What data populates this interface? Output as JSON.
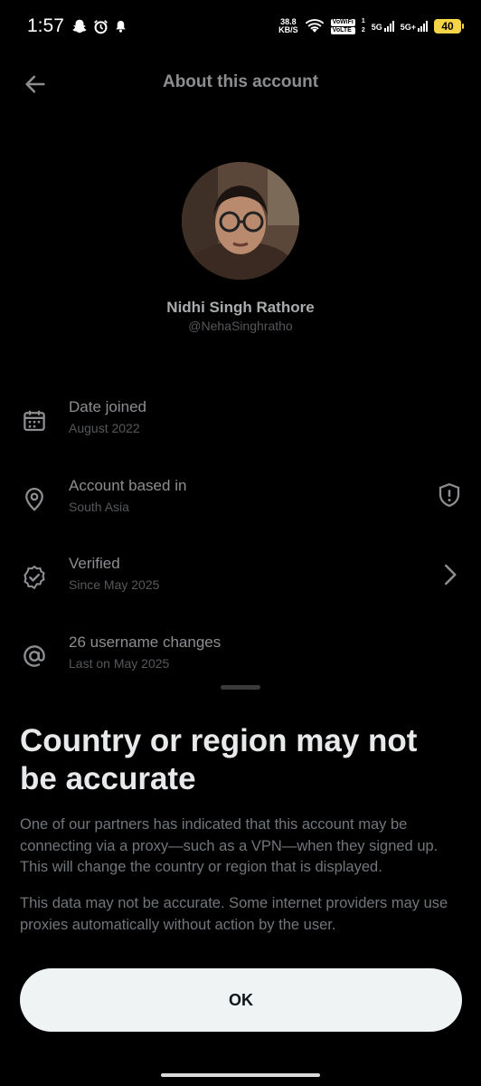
{
  "status_bar": {
    "time": "1:57",
    "speed_value": "38.8",
    "speed_unit": "KB/S",
    "vowifi": "VoWiFi",
    "volte": "VoLTE",
    "sim1": "1",
    "sim2": "2",
    "net1": "5G",
    "net2": "5G+",
    "battery": "40",
    "left_icons": [
      "snapchat-icon",
      "alarm-icon",
      "notification-bell-icon"
    ],
    "right_icons": [
      "wifi-icon",
      "signal-icon",
      "signal-icon",
      "battery-icon"
    ]
  },
  "header": {
    "title": "About this account",
    "back_icon": "back-arrow-icon"
  },
  "profile": {
    "name": "Nidhi Singh Rathore",
    "handle": "@NehaSinghratho"
  },
  "info_rows": [
    {
      "icon": "calendar-icon",
      "title": "Date joined",
      "subtitle": "August 2022"
    },
    {
      "icon": "location-pin-icon",
      "title": "Account based in",
      "subtitle": "South Asia",
      "action_icon": "shield-alert-icon"
    },
    {
      "icon": "verified-badge-icon",
      "title": "Verified",
      "subtitle": "Since May 2025",
      "action_icon": "chevron-right-icon"
    },
    {
      "icon": "at-sign-icon",
      "title": "26 username changes",
      "subtitle": "Last on May 2025"
    }
  ],
  "sheet": {
    "title": "Country or region may not be accurate",
    "paragraph1": "One of our partners has indicated that this account may be connecting via a proxy—such as a VPN—when they signed up. This will change the country or region that is displayed.",
    "paragraph2": "This data may not be accurate. Some internet providers may use proxies automatically without action by the user.",
    "ok_label": "OK"
  },
  "colors": {
    "background": "#000000",
    "sheet_title": "#e7e9ea",
    "muted_text": "#71767b",
    "button_bg": "#eff3f4",
    "battery": "#f5d547"
  }
}
